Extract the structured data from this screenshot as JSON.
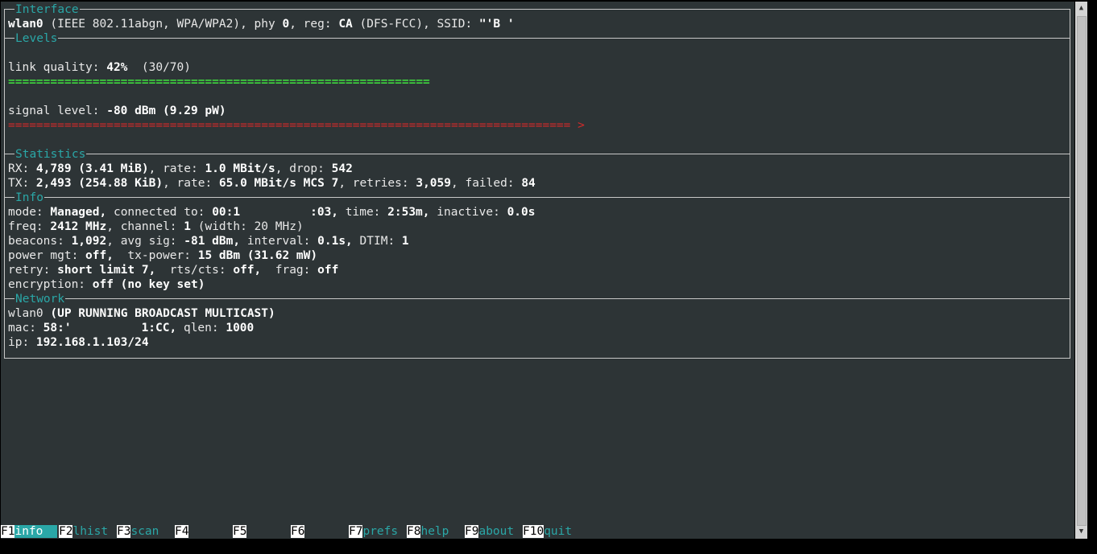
{
  "interface": {
    "title": "Interface",
    "name": "wlan0",
    "t1": " (IEEE 802.11abgn, WPA/WPA2), phy ",
    "phy": "0",
    "t2": ", reg: ",
    "reg": "CA",
    "t3": " (DFS-FCC), SSID: ",
    "ssid": "\"'B '"
  },
  "levels": {
    "title": "Levels",
    "lq_label": "link quality: ",
    "lq_value": "42%",
    "lq_extra": "  (30/70)",
    "lq_bar": "============================================================",
    "sig_label": "signal level: ",
    "sig_value": "-80 dBm (9.29 pW)",
    "sig_bar": "================================================================================",
    "sig_marker": " >",
    "link_quality_fraction": 0.42,
    "colors": {
      "good": "#3ed63e",
      "bad": "#d42a2a"
    }
  },
  "statistics": {
    "title": "Statistics",
    "rx_label": "RX: ",
    "rx_value": "4,789 (3.41 MiB)",
    "rx_rate_label": ", rate: ",
    "rx_rate": "1.0 MBit/s",
    "rx_drop_label": ", drop: ",
    "rx_drop": "542",
    "tx_label": "TX: ",
    "tx_value": "2,493 (254.88 KiB)",
    "tx_rate_label": ", rate: ",
    "tx_rate": "65.0 MBit/s MCS 7",
    "tx_retries_label": ", retries: ",
    "tx_retries": "3,059",
    "tx_failed_label": ", failed: ",
    "tx_failed": "84"
  },
  "info": {
    "title": "Info",
    "mode_label": "mode: ",
    "mode": "Managed,",
    "conn_label": " connected to: ",
    "mac1": "00:1",
    "mac2": ":03,",
    "time_label": " time: ",
    "time": "2:53m,",
    "inactive_label": " inactive: ",
    "inactive": "0.0s",
    "freq_label": "freq: ",
    "freq": "2412 MHz",
    "channel_label": ", channel: ",
    "channel": "1",
    "width": " (width: 20 MHz)",
    "beacons_label": "beacons: ",
    "beacons": "1,092",
    "avgsig_label": ", avg sig: ",
    "avgsig": "-81 dBm,",
    "interval_label": " interval: ",
    "interval": "0.1s,",
    "dtim_label": " DTIM: ",
    "dtim": "1",
    "pm_label": "power mgt: ",
    "pm": "off,",
    "txp_label": "  tx-power: ",
    "txp": "15 dBm (31.62 mW)",
    "retry_label": "retry: ",
    "retry": "short limit 7,",
    "rts_label": "  rts/cts: ",
    "rts": "off,",
    "frag_label": "  frag: ",
    "frag": "off",
    "enc_label": "encryption: ",
    "enc": "off (no key set)"
  },
  "network": {
    "title": "Network",
    "iface": "wlan0",
    "flags": "(UP RUNNING BROADCAST MULTICAST)",
    "mac_label": "mac: ",
    "mac1": "58:'",
    "mac2": "1:CC,",
    "qlen_label": " qlen: ",
    "qlen": "1000",
    "ip_label": "ip: ",
    "ip": "192.168.1.103/24"
  },
  "fkeys": [
    {
      "num": "F1",
      "label": "info  "
    },
    {
      "num": "F2",
      "label": "lhist"
    },
    {
      "num": "F3",
      "label": "scan"
    },
    {
      "num": "F4",
      "label": ""
    },
    {
      "num": "F5",
      "label": ""
    },
    {
      "num": "F6",
      "label": ""
    },
    {
      "num": "F7",
      "label": "prefs"
    },
    {
      "num": "F8",
      "label": "help"
    },
    {
      "num": "F9",
      "label": "about"
    },
    {
      "num": "F10",
      "label": "quit"
    }
  ],
  "scrollbar": {
    "up": "▲",
    "down": "▼"
  }
}
